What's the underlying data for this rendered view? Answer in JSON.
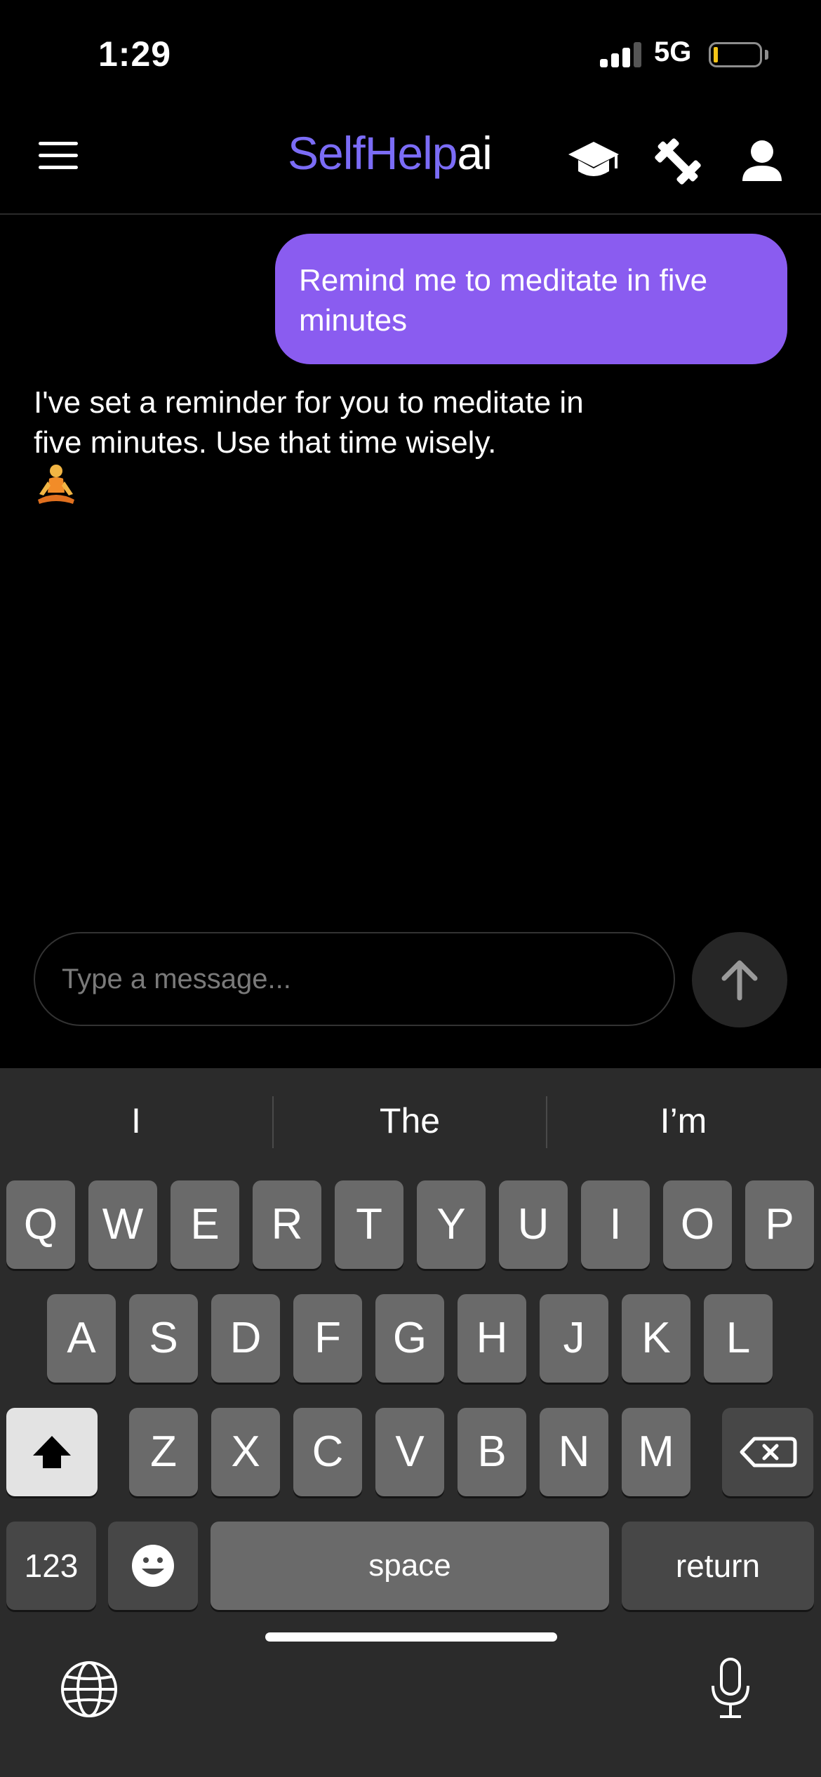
{
  "status_bar": {
    "time": "1:29",
    "network": "5G",
    "battery_color": "#f5c518"
  },
  "header": {
    "logo_part1": "SelfHelp",
    "logo_part2": "ai",
    "icons": [
      "menu-icon",
      "graduation-cap-icon",
      "dumbbell-icon",
      "user-icon"
    ]
  },
  "chat": {
    "user_message": "Remind me to meditate in five minutes",
    "ai_message": "I've set a reminder for you to meditate in five minutes. Use that time wisely.",
    "ai_emoji": "meditation-icon"
  },
  "composer": {
    "placeholder": "Type a message...",
    "send_icon": "arrow-up-icon"
  },
  "keyboard": {
    "suggestions": [
      "I",
      "The",
      "I’m"
    ],
    "row1": [
      "Q",
      "W",
      "E",
      "R",
      "T",
      "Y",
      "U",
      "I",
      "O",
      "P"
    ],
    "row2": [
      "A",
      "S",
      "D",
      "F",
      "G",
      "H",
      "J",
      "K",
      "L"
    ],
    "row3": [
      "Z",
      "X",
      "C",
      "V",
      "B",
      "N",
      "M"
    ],
    "numbers_label": "123",
    "space_label": "space",
    "return_label": "return"
  },
  "colors": {
    "accent": "#8a5cf0",
    "logo_accent": "#7b6cf6",
    "background": "#000000",
    "keyboard_bg": "#2b2b2b"
  }
}
